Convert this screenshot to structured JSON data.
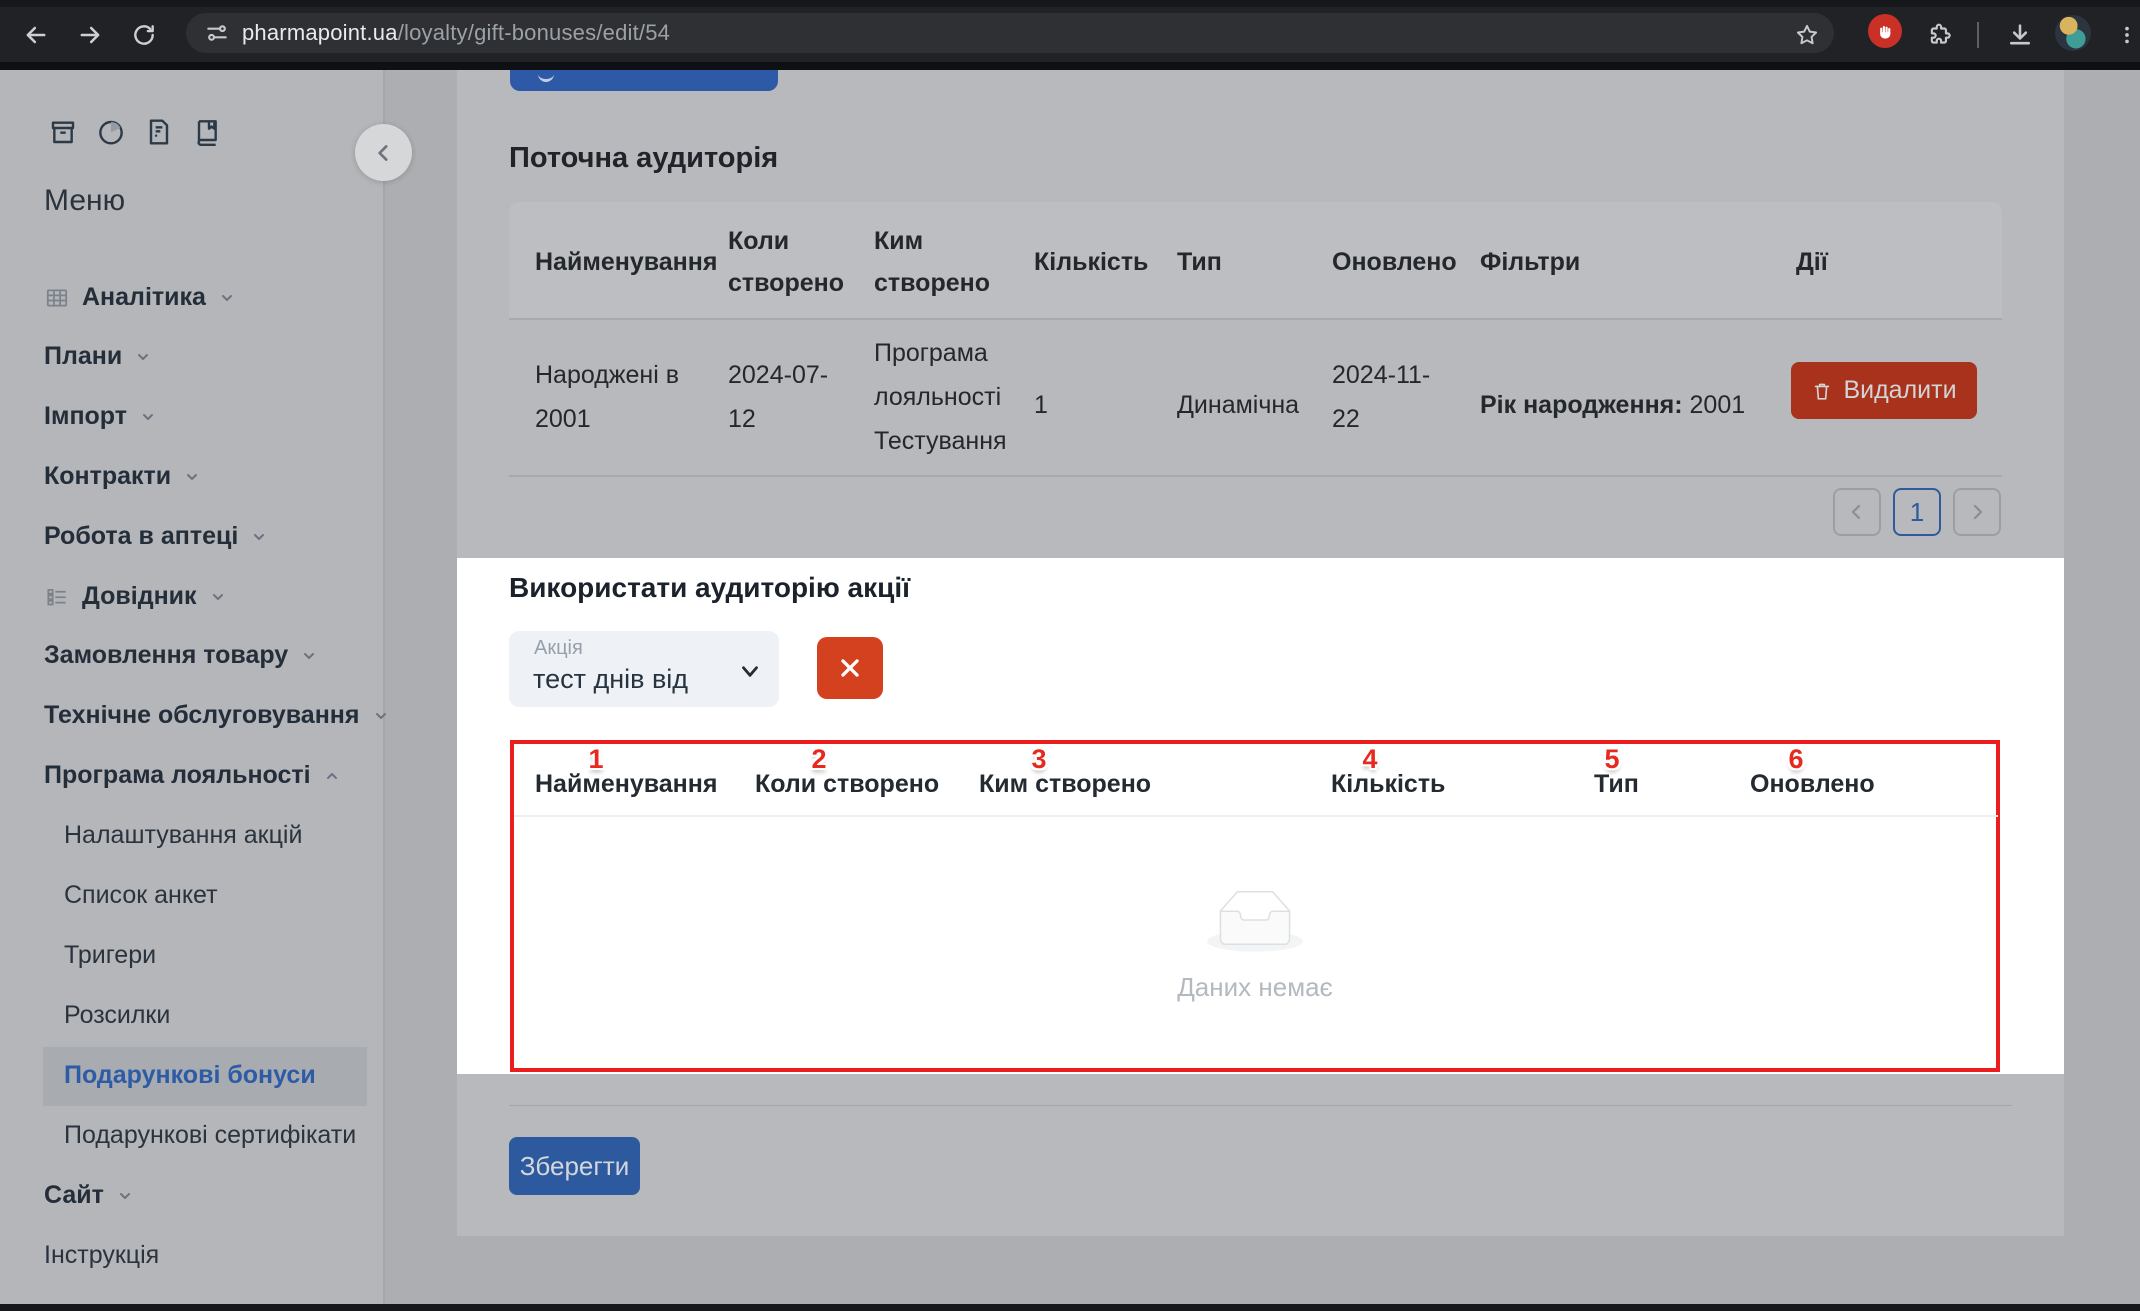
{
  "browser": {
    "url_domain": "pharmapoint.ua",
    "url_path": "/loyalty/gift-bonuses/edit/54"
  },
  "sidebar": {
    "menu_title": "Меню",
    "sections": [
      {
        "label": "Аналітика",
        "chevron": "down",
        "icon": "grid"
      },
      {
        "label": "Плани",
        "chevron": "down"
      },
      {
        "label": "Імпорт",
        "chevron": "down"
      },
      {
        "label": "Контракти",
        "chevron": "down"
      },
      {
        "label": "Робота в аптеці",
        "chevron": "down"
      },
      {
        "label": "Довідник",
        "chevron": "down",
        "icon": "list"
      },
      {
        "label": "Замовлення товару",
        "chevron": "down"
      },
      {
        "label": "Технічне обслуговування",
        "chevron": "down"
      },
      {
        "label": "Програма лояльності",
        "chevron": "up"
      }
    ],
    "loyalty_children": [
      "Налаштування акцій",
      "Список анкет",
      "Тригери",
      "Розсилки",
      "Подарункові бонуси",
      "Подарункові сертифікати"
    ],
    "active_item": "Подарункові бонуси",
    "bottom_sections": [
      {
        "label": "Сайт",
        "chevron": "down"
      },
      {
        "label": "Інструкція"
      }
    ]
  },
  "current_audience": {
    "title": "Поточна аудиторія",
    "columns": [
      "Найменування",
      "Коли створено",
      "Ким створено",
      "Кількість",
      "Тип",
      "Оновлено",
      "Фільтри",
      "Дії"
    ],
    "row": {
      "name": "Народжені в 2001",
      "created_at": "2024-07-12",
      "created_by": "Програма лояльності Тестування",
      "count": "1",
      "type": "Динамічна",
      "updated_at": "2024-11-22",
      "filter_label": "Рік народження:",
      "filter_value": " 2001",
      "delete_label": "Видалити"
    },
    "pagination": {
      "page": "1"
    }
  },
  "use_audience": {
    "title": "Використати аудиторію акції",
    "select_label": "Акція",
    "select_value": "тест днів від",
    "columns": [
      {
        "num": "1",
        "label": "Найменування"
      },
      {
        "num": "2",
        "label": "Коли створено"
      },
      {
        "num": "3",
        "label": "Ким створено"
      },
      {
        "num": "4",
        "label": "Кількість"
      },
      {
        "num": "5",
        "label": "Тип"
      },
      {
        "num": "6",
        "label": "Оновлено"
      }
    ],
    "empty_text": "Даних немає"
  },
  "footer": {
    "save_label": "Зберегти"
  },
  "colors": {
    "accent_blue": "#2d5a9e",
    "accent_red_button": "#d4411e",
    "delete_red": "#a8321b",
    "annotation_red": "#ec1d1d",
    "active_link_blue": "#2d5ba6",
    "highlight_white": "#ffffff",
    "dim_overlay_gray": "#b7b9bc"
  }
}
